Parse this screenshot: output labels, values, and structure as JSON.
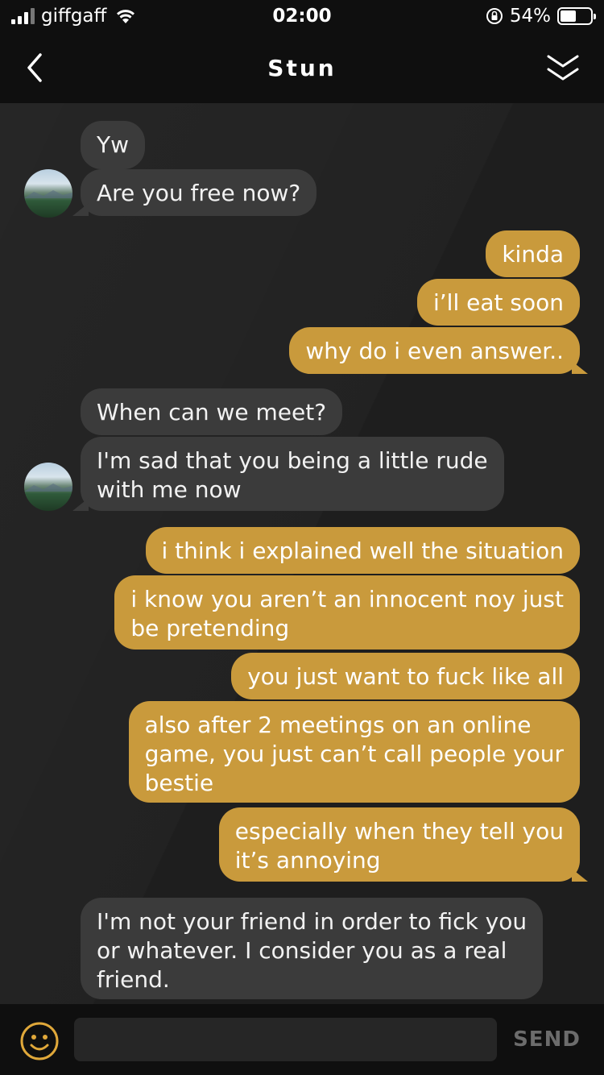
{
  "status_bar": {
    "carrier": "giffgaff",
    "time": "02:00",
    "battery_percent_label": "54%",
    "battery_level": 0.54
  },
  "header": {
    "title": "Stun",
    "back_icon": "chevron-left-icon",
    "collapse_icon": "double-chevron-down-icon"
  },
  "messages": [
    {
      "from": "them",
      "text": "Yw"
    },
    {
      "from": "them",
      "text": "Are you free now?"
    },
    {
      "from": "me",
      "text": "kinda"
    },
    {
      "from": "me",
      "text": "i’ll eat soon"
    },
    {
      "from": "me",
      "text": "why do i even answer.."
    },
    {
      "from": "them",
      "text": "When can we meet?"
    },
    {
      "from": "them",
      "text": "I'm sad that you being a little rude\nwith me now"
    },
    {
      "from": "me",
      "text": "i think i explained well the situation"
    },
    {
      "from": "me",
      "text": "i know you aren’t an innocent noy just\nbe pretending"
    },
    {
      "from": "me",
      "text": "you just want to fuck like all"
    },
    {
      "from": "me",
      "text": "also after 2 meetings on an online\ngame, you just can’t call people your\nbestie"
    },
    {
      "from": "me",
      "text": "especially when they tell you\nit’s annoying"
    },
    {
      "from": "them",
      "text": "I'm not your friend in order to fick you\nor whatever. I consider you as a real\nfriend."
    }
  ],
  "composer": {
    "placeholder": "",
    "value": "",
    "send_label": "SEND",
    "emoji_icon": "smiley-icon"
  },
  "colors": {
    "incoming_bubble": "#3b3b3b",
    "outgoing_bubble": "#c99a3c",
    "background": "#1e1e1e",
    "bars": "#0f0f0f",
    "accent": "#e0a83a"
  }
}
